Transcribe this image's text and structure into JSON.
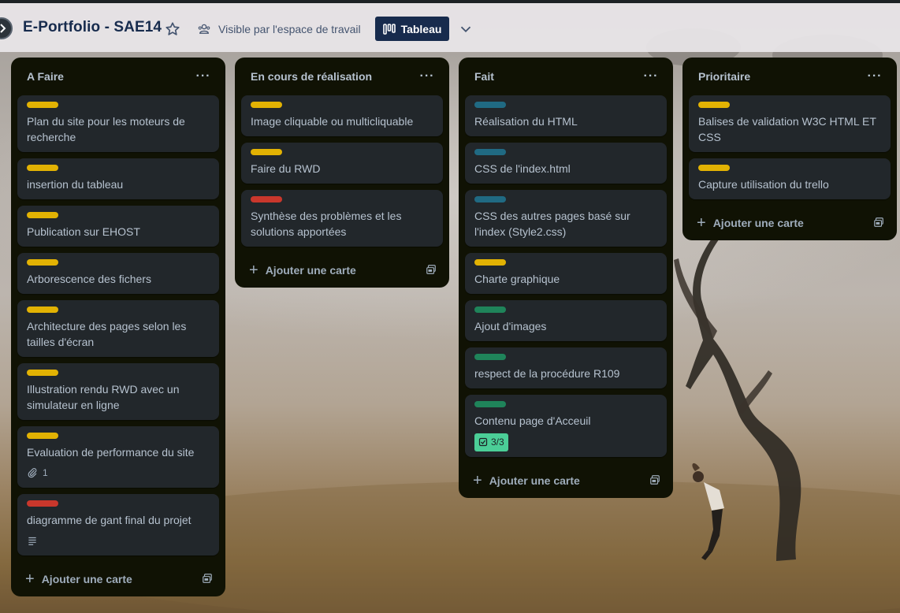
{
  "board": {
    "title": "E-Portfolio - SAE14",
    "visibility_label": "Visible par l'espace de travail",
    "view_label": "Tableau"
  },
  "colors": {
    "yellow": "#e2b203",
    "red": "#c9372c",
    "teal": "#206a83",
    "green": "#1f845a"
  },
  "lists": [
    {
      "title": "A Faire",
      "add_label": "Ajouter une carte",
      "cards": [
        {
          "label": "yellow",
          "text": "Plan du site pour les moteurs de recherche"
        },
        {
          "label": "yellow",
          "text": "insertion du tableau"
        },
        {
          "label": "yellow",
          "text": "Publication sur EHOST"
        },
        {
          "label": "yellow",
          "text": "Arborescence des fichers"
        },
        {
          "label": "yellow",
          "text": "Architecture des pages selon les tailles d'écran"
        },
        {
          "label": "yellow",
          "text": "Illustration rendu RWD avec un simulateur en ligne"
        },
        {
          "label": "yellow",
          "text": "Evaluation de performance du site",
          "attachments": "1"
        },
        {
          "label": "red",
          "text": "diagramme de gant final du projet",
          "description_icon": "description-icon"
        }
      ]
    },
    {
      "title": "En cours de réalisation",
      "add_label": "Ajouter une carte",
      "cards": [
        {
          "label": "yellow",
          "text": "Image cliquable ou multicliquable"
        },
        {
          "label": "yellow",
          "text": "Faire du RWD"
        },
        {
          "label": "red",
          "text": "Synthèse des problèmes et les solutions apportées"
        }
      ]
    },
    {
      "title": "Fait",
      "add_label": "Ajouter une carte",
      "cards": [
        {
          "label": "teal",
          "text": "Réalisation du HTML"
        },
        {
          "label": "teal",
          "text": "CSS de l'index.html"
        },
        {
          "label": "teal",
          "text": "CSS des autres pages basé sur l'index (Style2.css)"
        },
        {
          "label": "yellow",
          "text": "Charte graphique"
        },
        {
          "label": "green",
          "text": "Ajout d'images"
        },
        {
          "label": "green",
          "text": "respect de la procédure R109"
        },
        {
          "label": "green",
          "text": "Contenu page d'Acceuil",
          "checklist": "3/3"
        }
      ]
    },
    {
      "title": "Prioritaire",
      "add_label": "Ajouter une carte",
      "cards": [
        {
          "label": "yellow",
          "text": "Balises de validation W3C HTML ET CSS"
        },
        {
          "label": "yellow",
          "text": "Capture utilisation du trello"
        }
      ]
    }
  ]
}
